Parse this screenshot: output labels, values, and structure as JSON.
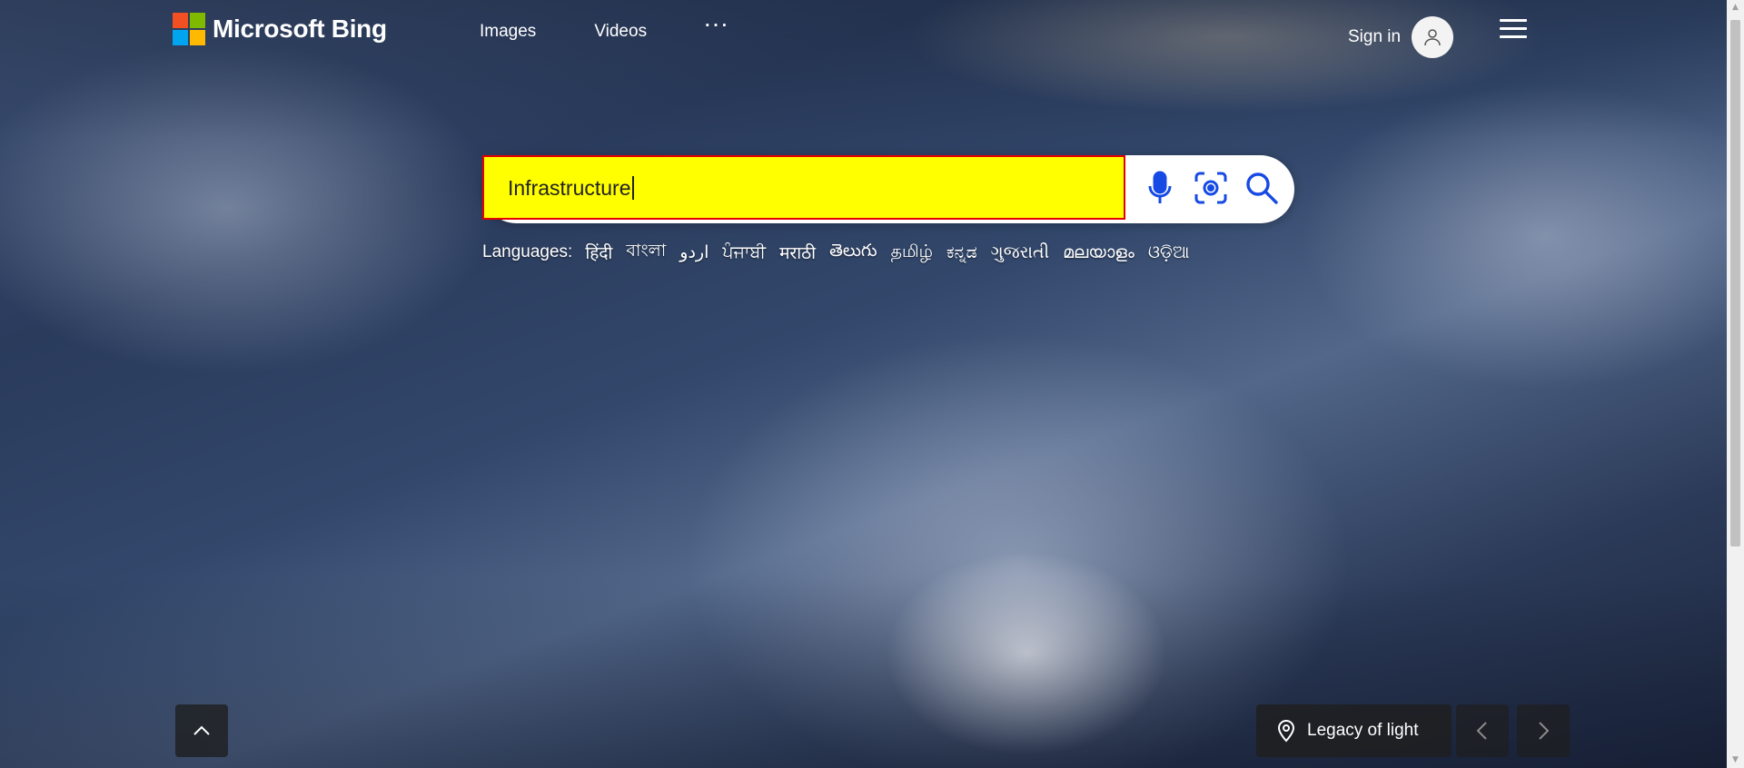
{
  "colors": {
    "logo_red": "#f25022",
    "logo_green": "#7fba00",
    "logo_blue": "#00a4ef",
    "logo_yellow": "#ffb900",
    "search_highlight": "#ffff00",
    "search_border": "#e60000",
    "icon_teal": "#174ae4"
  },
  "header": {
    "brand": "Microsoft Bing",
    "nav": [
      {
        "label": "Images"
      },
      {
        "label": "Videos"
      },
      {
        "label": "···"
      }
    ],
    "sign_in_label": "Sign in"
  },
  "search": {
    "value": "Infrastructure",
    "voice_icon": "microphone-icon",
    "visual_icon": "visual-search-icon",
    "search_icon": "search-icon"
  },
  "languages": {
    "label": "Languages:",
    "items": [
      "हिंदी",
      "বাংলা",
      "اردو",
      "ਪੰਜਾਬੀ",
      "मराठी",
      "తెలుగు",
      "தமிழ்",
      "ಕನ್ನಡ",
      "ગુજરાતી",
      "മലയാളം",
      "ଓଡ଼ିଆ"
    ]
  },
  "footer": {
    "image_caption": "Legacy of light",
    "location_icon": "location-pin-icon",
    "prev_icon": "chevron-left-icon",
    "next_icon": "chevron-right-icon",
    "scroll_up_icon": "chevron-up-icon"
  }
}
